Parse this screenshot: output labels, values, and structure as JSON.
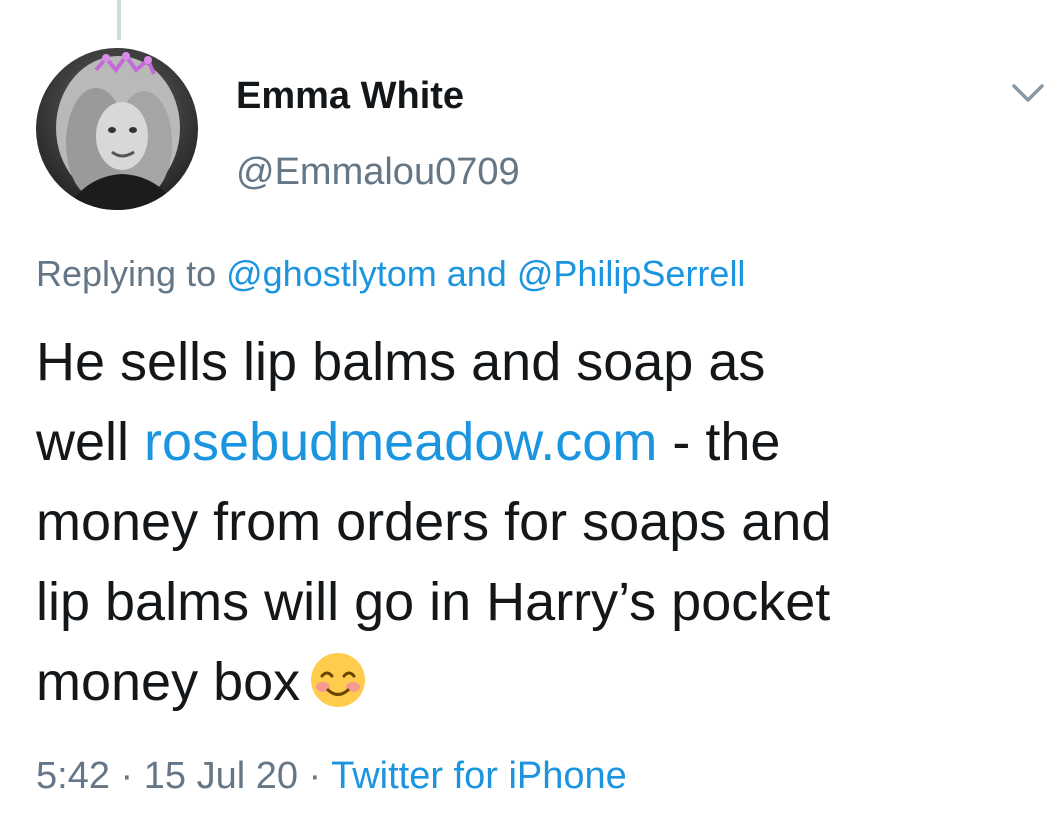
{
  "tweet": {
    "author": {
      "display_name": "Emma White",
      "handle": "@Emmalou0709"
    },
    "reply": {
      "prefix": "Replying to ",
      "mention_1": "@ghostlytom",
      "joiner": " and ",
      "mention_2": "@PhilipSerrell"
    },
    "body": {
      "line_1": "He sells lip balms and soap as",
      "line_2_start": "well ",
      "line_2_link": "rosebudmeadow.com",
      "line_2_end": " - the",
      "line_3": "money from orders for soaps and",
      "line_4": "lip balms will go in Harry’s pocket",
      "line_5": "money box"
    },
    "emoji_name": "smiling-face-with-smiling-eyes",
    "meta": {
      "time": "5:42",
      "sep_1": " · ",
      "date": "15 Jul 20",
      "sep_2": " · ",
      "source": "Twitter for iPhone"
    },
    "icons": {
      "menu": "chevron-down-icon"
    },
    "colors": {
      "link": "#1b95e0",
      "secondary_text": "#657786",
      "primary_text": "#14171a",
      "thread_line": "#cfd9de"
    }
  }
}
